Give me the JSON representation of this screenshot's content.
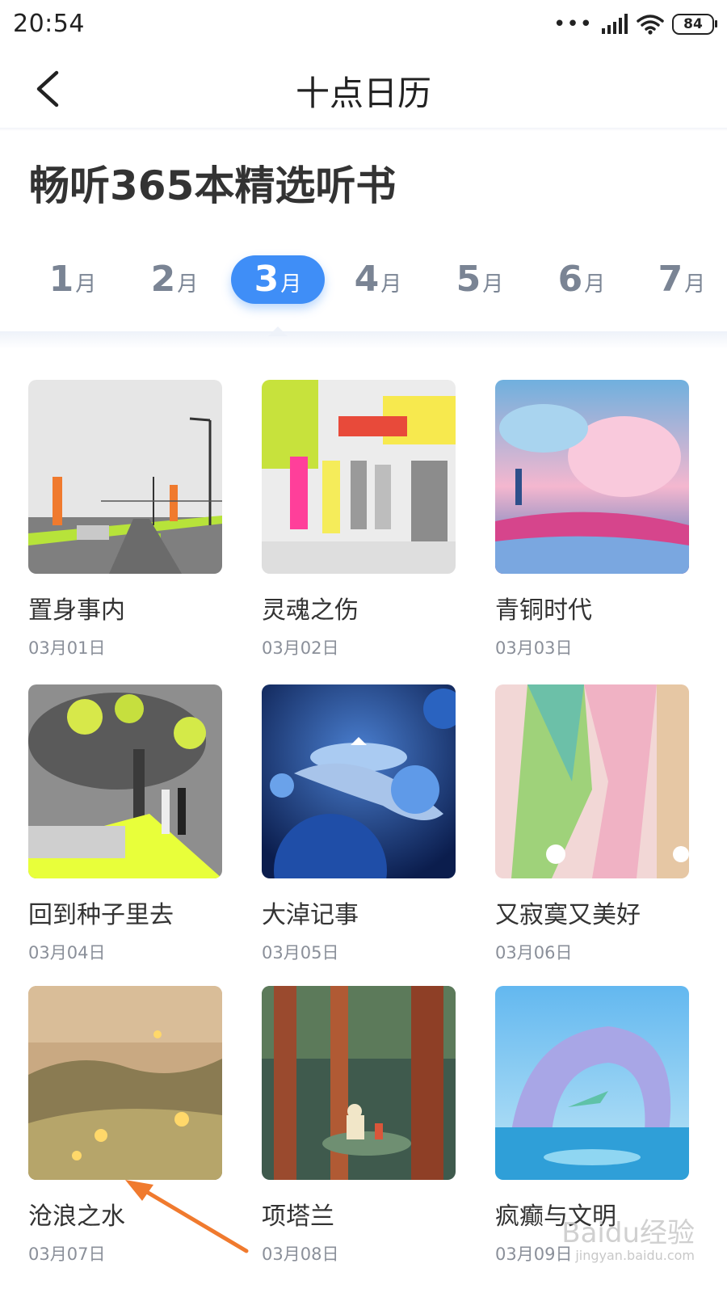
{
  "status": {
    "time": "20:54",
    "battery": "84",
    "icons": [
      "dots-icon",
      "signal-icon",
      "wifi-icon",
      "battery-icon"
    ]
  },
  "nav": {
    "title": "十点日历",
    "back_icon": "back-chevron-icon"
  },
  "page": {
    "title": "畅听365本精选听书"
  },
  "tabs": [
    {
      "num": "1",
      "unit": "月",
      "active": false
    },
    {
      "num": "2",
      "unit": "月",
      "active": false
    },
    {
      "num": "3",
      "unit": "月",
      "active": true
    },
    {
      "num": "4",
      "unit": "月",
      "active": false
    },
    {
      "num": "5",
      "unit": "月",
      "active": false
    },
    {
      "num": "6",
      "unit": "月",
      "active": false
    },
    {
      "num": "7",
      "unit": "月",
      "active": false
    }
  ],
  "books": [
    {
      "title": "置身事内",
      "date": "03月01日"
    },
    {
      "title": "灵魂之伤",
      "date": "03月02日"
    },
    {
      "title": "青铜时代",
      "date": "03月03日"
    },
    {
      "title": "回到种子里去",
      "date": "03月04日"
    },
    {
      "title": "大淖记事",
      "date": "03月05日"
    },
    {
      "title": "又寂寞又美好",
      "date": "03月06日"
    },
    {
      "title": "沧浪之水",
      "date": "03月07日"
    },
    {
      "title": "项塔兰",
      "date": "03月08日"
    },
    {
      "title": "疯癫与文明",
      "date": "03月09日"
    }
  ],
  "colors": {
    "accent": "#3f8ef7",
    "annotation_arrow": "#f07a2e"
  },
  "watermark": {
    "brand": "Baidu经验",
    "url": "jingyan.baidu.com"
  }
}
